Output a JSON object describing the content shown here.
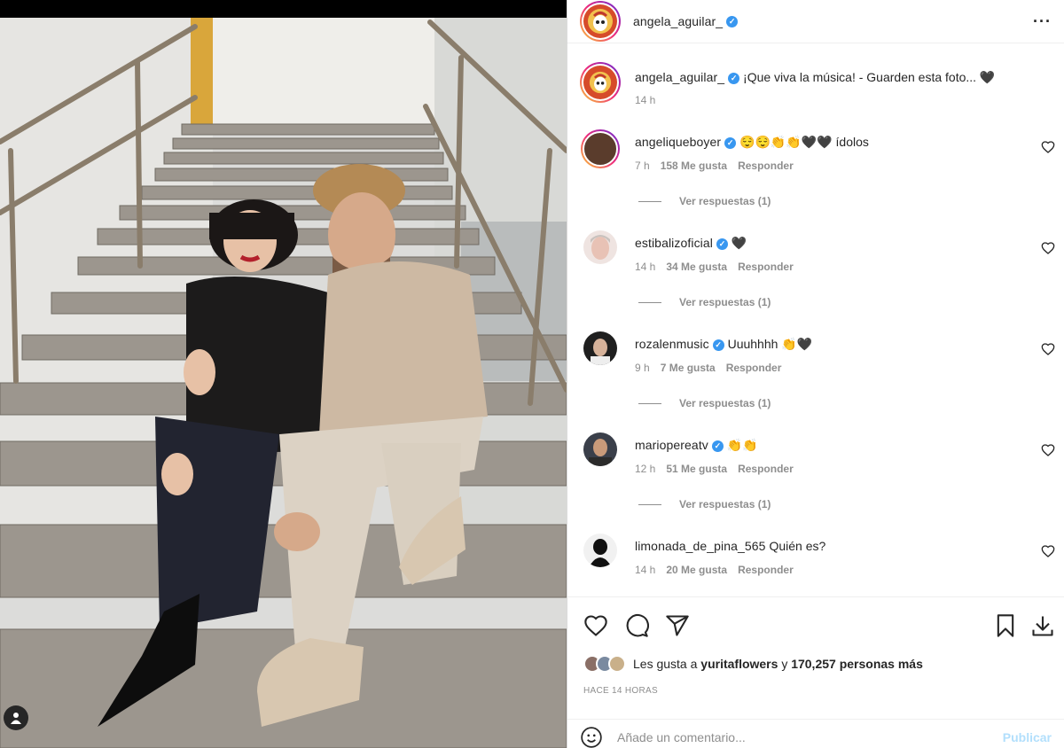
{
  "post": {
    "author": "angela_aguilar_",
    "more_icon": "more-horizontal-icon"
  },
  "caption": {
    "username": "angela_aguilar_",
    "text": "¡Que viva la música! - Guarden esta foto... 🖤",
    "time": "14 h"
  },
  "comments": [
    {
      "username": "angeliqueboyer",
      "verified": true,
      "text": "😌😌👏👏🖤🖤 ídolos",
      "time": "7 h",
      "likes": "158 Me gusta",
      "reply": "Responder",
      "view_replies": "Ver respuestas (1)"
    },
    {
      "username": "estibalizoficial",
      "verified": true,
      "text": "🖤",
      "time": "14 h",
      "likes": "34 Me gusta",
      "reply": "Responder",
      "view_replies": "Ver respuestas (1)"
    },
    {
      "username": "rozalenmusic",
      "verified": true,
      "text": "Uuuhhhh 👏🖤",
      "time": "9 h",
      "likes": "7 Me gusta",
      "reply": "Responder",
      "view_replies": "Ver respuestas (1)"
    },
    {
      "username": "marioperеatv",
      "verified": true,
      "text": "👏👏",
      "time": "12 h",
      "likes": "51 Me gusta",
      "reply": "Responder",
      "view_replies": "Ver respuestas (1)"
    },
    {
      "username": "limonada_de_pina_565",
      "verified": false,
      "text": "Quién es?",
      "time": "14 h",
      "likes": "20 Me gusta",
      "reply": "Responder"
    }
  ],
  "likes": {
    "prefix": "Les gusta a",
    "user": "yuritaflowers",
    "mid": "y",
    "count": "170,257 personas más"
  },
  "time_ago": "HACE 14 HORAS",
  "comment_box": {
    "placeholder": "Añade un comentario...",
    "publish": "Publicar"
  },
  "colors": {
    "verified": "#3897f0",
    "muted": "#8e8e8e",
    "publish_disabled": "#b2dffc"
  }
}
